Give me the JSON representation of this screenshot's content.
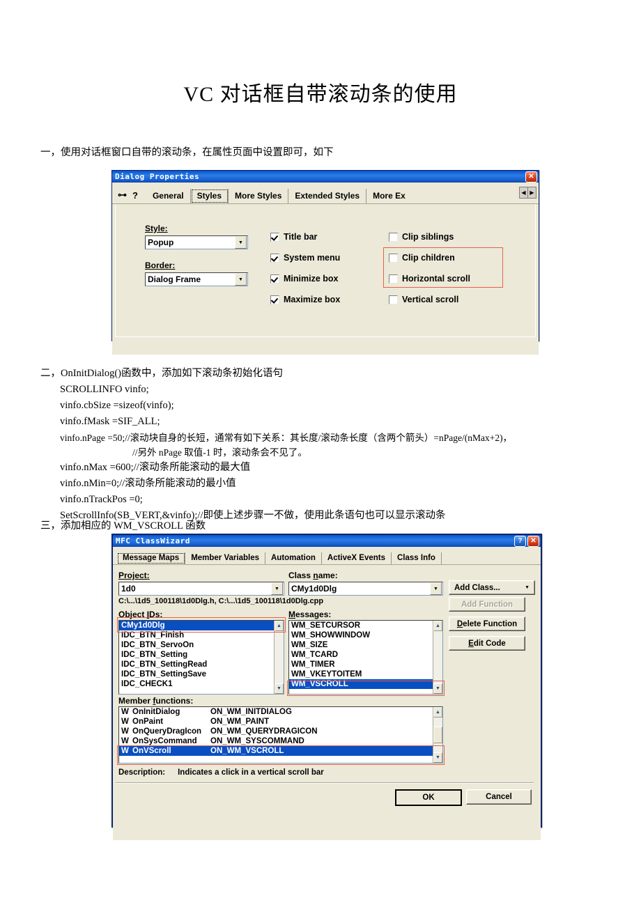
{
  "document": {
    "title": "VC 对话框自带滚动条的使用",
    "section1": "一，使用对话框窗口自带的滚动条，在属性页面中设置即可，如下",
    "section2": "二，OnInitDialog()函数中，添加如下滚动条初始化语句",
    "code": [
      "SCROLLINFO vinfo;",
      "vinfo.cbSize =sizeof(vinfo);",
      "vinfo.fMask =SIF_ALL;",
      "vinfo.nPage =50;//滚动块自身的长短，通常有如下关系：其长度/滚动条长度（含两个箭头）=nPage/(nMax+2)，",
      "//另外 nPage 取值-1 时，滚动条会不见了。",
      "vinfo.nMax =600;//滚动条所能滚动的最大值",
      "vinfo.nMin=0;//滚动条所能滚动的最小值",
      "vinfo.nTrackPos =0;",
      "SetScrollInfo(SB_VERT,&vinfo);//即使上述步骤一不做，使用此条语句也可以显示滚动条"
    ],
    "section3": "三，添加相应的 WM_VSCROLL 函数"
  },
  "dialog_properties": {
    "title": "Dialog Properties",
    "close_label": "✕",
    "pin_icon": "pushpin-icon",
    "help_icon": "question-icon",
    "tabs": [
      {
        "label": "General",
        "active": false
      },
      {
        "label": "Styles",
        "active": true
      },
      {
        "label": "More Styles",
        "active": false
      },
      {
        "label": "Extended Styles",
        "active": false
      },
      {
        "label": "More Ex",
        "active": false
      }
    ],
    "style_label": "Style:",
    "style_value": "Popup",
    "border_label": "Border:",
    "border_value": "Dialog Frame",
    "checkboxes_col1": [
      {
        "label": "Title bar",
        "checked": true
      },
      {
        "label": "System menu",
        "checked": true
      },
      {
        "label": "Minimize box",
        "checked": true
      },
      {
        "label": "Maximize box",
        "checked": true
      }
    ],
    "checkboxes_col2": [
      {
        "label": "Clip siblings",
        "checked": false
      },
      {
        "label": "Clip children",
        "checked": false
      },
      {
        "label": "Horizontal scroll",
        "checked": false
      },
      {
        "label": "Vertical scroll",
        "checked": false
      }
    ],
    "highlight_color": "#e8604c"
  },
  "class_wizard": {
    "title": "MFC ClassWizard",
    "help_label": "?",
    "close_label": "✕",
    "tabs": [
      {
        "label": "Message Maps",
        "active": true
      },
      {
        "label": "Member Variables",
        "active": false
      },
      {
        "label": "Automation",
        "active": false
      },
      {
        "label": "ActiveX Events",
        "active": false
      },
      {
        "label": "Class Info",
        "active": false
      }
    ],
    "project_label": "Project:",
    "project_value": "1d0",
    "class_name_label": "Class name:",
    "class_name_value": "CMy1d0Dlg",
    "file_paths": "C:\\...\\1d5_100118\\1d0Dlg.h, C:\\...\\1d5_100118\\1d0Dlg.cpp",
    "object_ids_label": "Object IDs:",
    "object_ids": [
      {
        "label": "CMy1d0Dlg",
        "selected": true
      },
      {
        "label": "IDC_BTN_Finish",
        "selected": false
      },
      {
        "label": "IDC_BTN_ServoOn",
        "selected": false
      },
      {
        "label": "IDC_BTN_Setting",
        "selected": false
      },
      {
        "label": "IDC_BTN_SettingRead",
        "selected": false
      },
      {
        "label": "IDC_BTN_SettingSave",
        "selected": false
      },
      {
        "label": "IDC_CHECK1",
        "selected": false
      }
    ],
    "messages_label": "Messages:",
    "messages": [
      {
        "label": "WM_SETCURSOR",
        "selected": false
      },
      {
        "label": "WM_SHOWWINDOW",
        "selected": false
      },
      {
        "label": "WM_SIZE",
        "selected": false
      },
      {
        "label": "WM_TCARD",
        "selected": false
      },
      {
        "label": "WM_TIMER",
        "selected": false
      },
      {
        "label": "WM_VKEYTOITEM",
        "selected": false
      },
      {
        "label": "WM_VSCROLL",
        "selected": true
      }
    ],
    "member_functions_label": "Member functions:",
    "member_functions": [
      {
        "mark": "W",
        "name": "OnInitDialog",
        "message": "ON_WM_INITDIALOG",
        "selected": false
      },
      {
        "mark": "W",
        "name": "OnPaint",
        "message": "ON_WM_PAINT",
        "selected": false
      },
      {
        "mark": "W",
        "name": "OnQueryDragIcon",
        "message": "ON_WM_QUERYDRAGICON",
        "selected": false
      },
      {
        "mark": "W",
        "name": "OnSysCommand",
        "message": "ON_WM_SYSCOMMAND",
        "selected": false
      },
      {
        "mark": "W",
        "name": "OnVScroll",
        "message": "ON_WM_VSCROLL",
        "selected": true
      }
    ],
    "description_label": "Description:",
    "description_text": "Indicates a click in a vertical scroll bar",
    "side_buttons": [
      {
        "label": "Add Class...",
        "disabled": false,
        "dropdown": true
      },
      {
        "label": "Add Function",
        "disabled": true,
        "dropdown": false
      },
      {
        "label": "Delete Function",
        "disabled": false,
        "dropdown": false
      },
      {
        "label": "Edit Code",
        "disabled": false,
        "dropdown": false
      }
    ],
    "ok_label": "OK",
    "cancel_label": "Cancel",
    "highlight_color": "#e8604c"
  }
}
